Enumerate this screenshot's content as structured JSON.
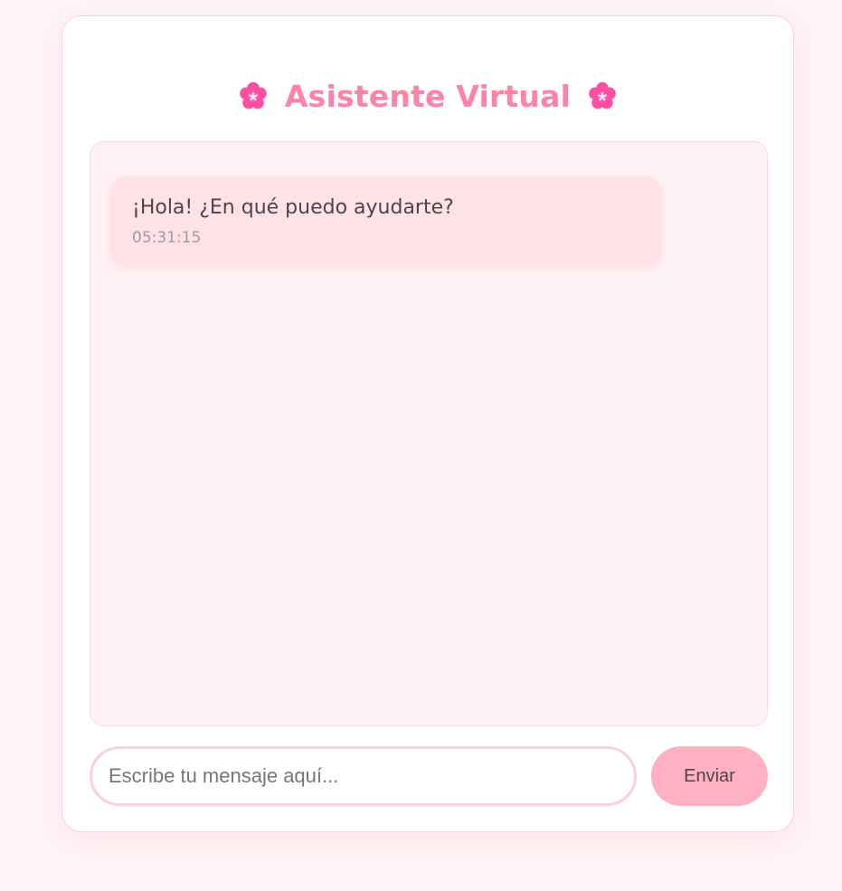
{
  "header": {
    "title": "Asistente Virtual",
    "left_icon": "cherry-blossom-icon",
    "right_icon": "cherry-blossom-icon"
  },
  "chat": {
    "messages": [
      {
        "text": "¡Hola! ¿En qué puedo ayudarte?",
        "time": "05:31:15"
      }
    ]
  },
  "composer": {
    "placeholder": "Escribe tu mensaje aquí...",
    "value": "",
    "send_label": "Enviar"
  },
  "colors": {
    "accent": "#ff83a6",
    "bubble": "#ffe1e8",
    "button": "#ffb1c3",
    "background": "#fff3f5"
  }
}
